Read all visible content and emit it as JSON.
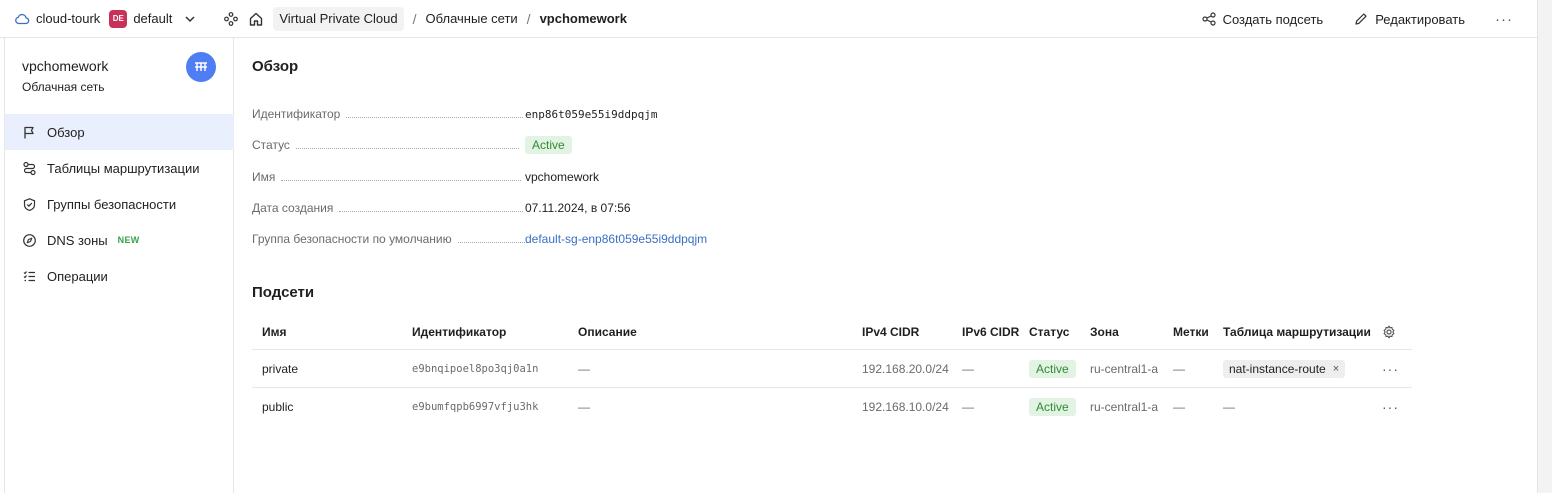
{
  "topbar": {
    "cloud_name": "cloud-tourk",
    "folder_badge": "DE",
    "folder_name": "default",
    "breadcrumbs": [
      "Virtual Private Cloud",
      "Облачные сети",
      "vpchomework"
    ],
    "separator": "/",
    "create_subnet": "Создать подсеть",
    "edit": "Редактировать",
    "more": "···"
  },
  "resource": {
    "title": "vpchomework",
    "subtitle": "Облачная сеть"
  },
  "sidebar": {
    "items": [
      {
        "label": "Обзор",
        "icon": "flag-icon",
        "active": true
      },
      {
        "label": "Таблицы маршрутизации",
        "icon": "route-icon"
      },
      {
        "label": "Группы безопасности",
        "icon": "shield-icon"
      },
      {
        "label": "DNS зоны",
        "icon": "compass-icon",
        "badge": "NEW"
      },
      {
        "label": "Операции",
        "icon": "list-icon"
      }
    ]
  },
  "overview": {
    "heading": "Обзор",
    "props": [
      {
        "label": "Идентификатор",
        "value": "enp86t059e55i9ddpqjm"
      },
      {
        "label": "Статус",
        "value": "Active"
      },
      {
        "label": "Имя",
        "value": "vpchomework"
      },
      {
        "label": "Дата создания",
        "value": "07.11.2024, в 07:56"
      },
      {
        "label": "Группа безопасности по умолчанию",
        "value": "default-sg-enp86t059e55i9ddpqjm"
      }
    ]
  },
  "subnets": {
    "heading": "Подсети",
    "columns": [
      "Имя",
      "Идентификатор",
      "Описание",
      "IPv4 CIDR",
      "IPv6 CIDR",
      "Статус",
      "Зона",
      "Метки",
      "Таблица маршрутизации"
    ],
    "rows": [
      {
        "name": "private",
        "id": "e9bnqipoel8po3qj0a1n",
        "desc": "—",
        "ipv4": "192.168.20.0/24",
        "ipv6": "—",
        "status": "Active",
        "zone": "ru-central1-a",
        "labels": "—",
        "route": "nat-instance-route",
        "route_remove": "×",
        "more": "···"
      },
      {
        "name": "public",
        "id": "e9bumfqpb6997vfju3hk",
        "desc": "—",
        "ipv4": "192.168.10.0/24",
        "ipv6": "—",
        "status": "Active",
        "zone": "ru-central1-a",
        "labels": "—",
        "route": "—",
        "more": "···"
      }
    ]
  },
  "colors": {
    "accent": "#4f7df4",
    "active_bg": "#e9effc",
    "status_green": "#2e8b35",
    "folder_badge": "#c8325a",
    "link": "#3a6fc4"
  }
}
